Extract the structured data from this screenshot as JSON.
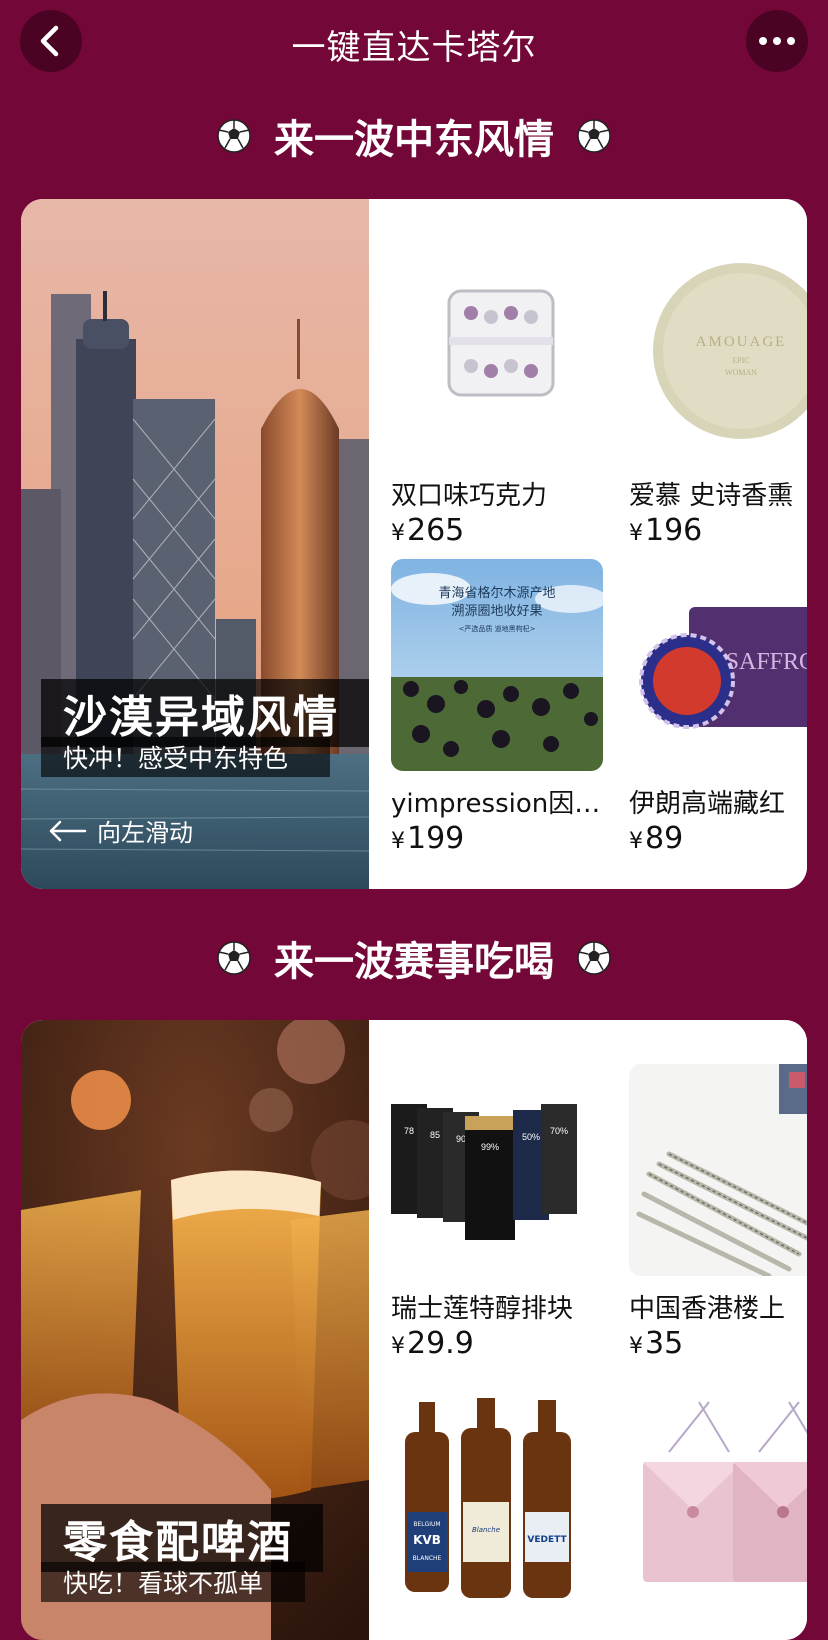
{
  "header": {
    "title": "一键直达卡塔尔"
  },
  "sections": [
    {
      "title": "来一波中东风情",
      "banner": {
        "title": "沙漠异域风情",
        "subtitle": "快冲！感受中东特色",
        "hint": "向左滑动"
      },
      "products": [
        {
          "name": "双口味巧克力",
          "price": "265"
        },
        {
          "name": "爱慕 史诗香熏",
          "price": "196"
        },
        {
          "name": "yimpression因…",
          "price": "199"
        },
        {
          "name": "伊朗高端藏红",
          "price": "89"
        }
      ],
      "goji_text": {
        "line1": "青海省格尔木源产地",
        "line2": "溯源圈地收好果",
        "line3": "<严选品质 道地黑枸杞>",
        "small": "yuan chan di"
      },
      "soap_text": {
        "brand": "AMOUAGE",
        "line2": "EPIC",
        "line3": "WOMAN"
      },
      "saffron_text": "SAFFRO"
    },
    {
      "title": "来一波赛事吃喝",
      "banner": {
        "title": "零食配啤酒",
        "subtitle": "快吃！看球不孤单"
      },
      "products": [
        {
          "name": "瑞士莲特醇排块",
          "price": "29.9"
        },
        {
          "name": "中国香港楼上",
          "price": "35"
        },
        {
          "name": "",
          "price": ""
        },
        {
          "name": "",
          "price": ""
        }
      ],
      "choc_labels": [
        "78",
        "85",
        "90",
        "99%",
        "50%",
        "70%"
      ],
      "beer_labels": [
        "BELGIUM",
        "KVB",
        "BLANCHE",
        "Blanche de Namur",
        "VEDETT"
      ]
    }
  ],
  "currency": "¥",
  "colors": {
    "background": "#730738",
    "card": "#ffffff"
  }
}
